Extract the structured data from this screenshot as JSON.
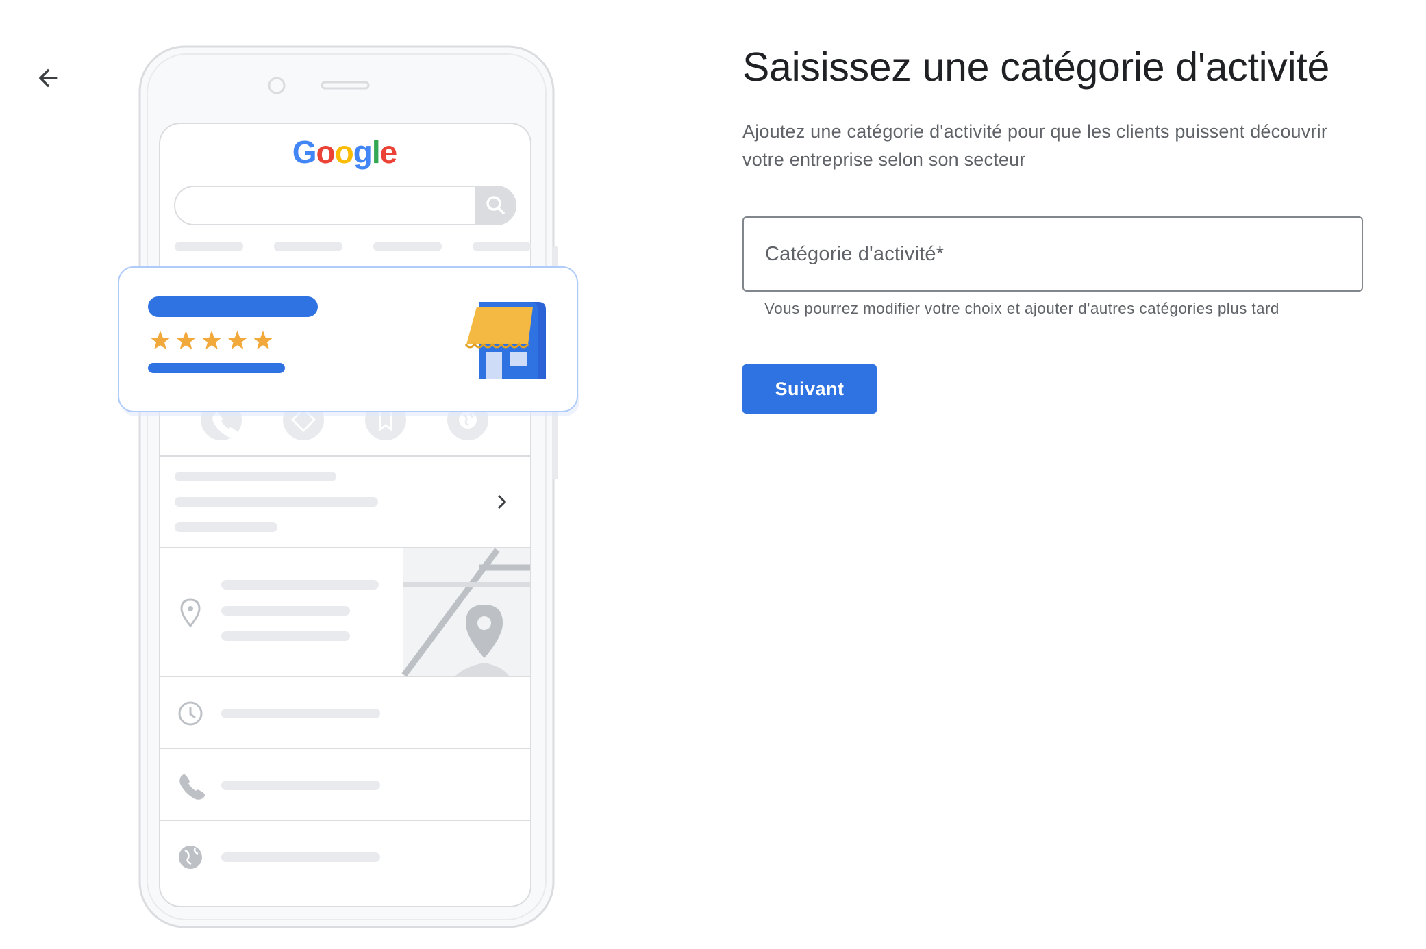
{
  "nav": {
    "back_icon": "arrow-left-icon"
  },
  "illustration": {
    "logo_text": "Google",
    "logo_colors": [
      "#4285F4",
      "#EA4335",
      "#FBBC05",
      "#4285F4",
      "#34A853",
      "#EA4335"
    ],
    "rating_stars": 5,
    "accent_color": "#2f73e3",
    "star_color": "#F2A93B",
    "awning_color": "#F4B942"
  },
  "form": {
    "title": "Saisissez une catégorie d'activité",
    "description": "Ajoutez une catégorie d'activité pour que les clients puissent découvrir votre entreprise selon son secteur",
    "category_label": "Catégorie d'activité*",
    "category_value": "",
    "helper_text": "Vous pourrez modifier votre choix et ajouter d'autres catégories plus tard",
    "next_label": "Suivant"
  }
}
